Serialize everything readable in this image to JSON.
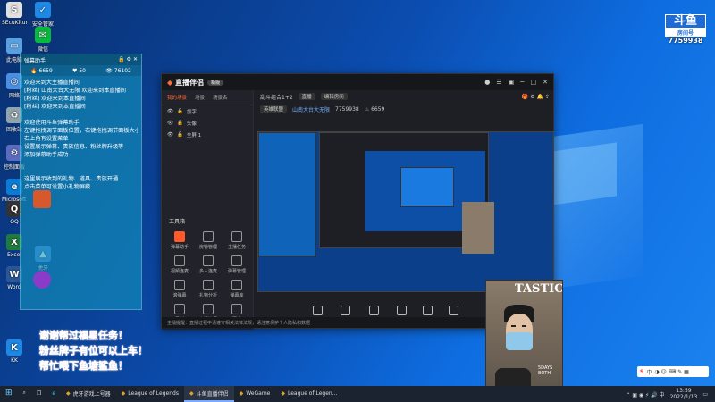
{
  "desktop": {
    "icons": [
      {
        "label": "SEcuKitunt",
        "glyph": "S",
        "color": "#e0e0e0"
      },
      {
        "label": "安全管家",
        "glyph": "✓",
        "color": "#1e88e5"
      },
      {
        "label": "此电脑",
        "glyph": "▭",
        "color": "#5aa0e0"
      },
      {
        "label": "微信",
        "glyph": "✉",
        "color": "#09b83e"
      },
      {
        "label": "网络",
        "glyph": "◎",
        "color": "#4a90e2"
      },
      {
        "label": "回收站",
        "glyph": "♻",
        "color": "#90a4ae"
      },
      {
        "label": "控制面板",
        "glyph": "⚙",
        "color": "#5c6bc0"
      },
      {
        "label": "Microsoft Edge",
        "glyph": "e",
        "color": "#0a7cd6"
      },
      {
        "label": "QQ",
        "glyph": "Q",
        "color": "#333"
      },
      {
        "label": "Excel",
        "glyph": "X",
        "color": "#1f7a3f"
      },
      {
        "label": "Word",
        "glyph": "W",
        "color": "#2b5797"
      },
      {
        "label": "虎牙",
        "glyph": "▲",
        "color": "#4a7fd8"
      },
      {
        "label": "KK",
        "glyph": "K",
        "color": "#1e88e5"
      }
    ],
    "middle_icons": [
      {
        "glyph": "◆",
        "color": "#e06030"
      },
      {
        "glyph": "◆",
        "color": "#8a3cc8"
      }
    ]
  },
  "chat": {
    "title": "弹幕助手",
    "stats": [
      "6659",
      "50",
      "76102"
    ],
    "messages": [
      "欢迎来到大主播直播间",
      "[粉丝] 山南大台大无限  欢迎来到本直播间",
      "[粉丝]  欢迎来到本直播间",
      "[粉丝]  欢迎来到本直播间",
      "",
      "欢迎使用斗鱼弹幕助手",
      "左键拖拽调节面板位置，右键拖拽调节面板大小",
      "右上角有设置菜单",
      "设置展示弹幕、贵族信息、粉丝牌升级等",
      "添加弹幕助手成功",
      "",
      "",
      "这里展示收到的礼物、道具、贵族开通",
      "点击菜单可设置小礼物屏蔽"
    ]
  },
  "overlay_text": [
    "谢谢帮过福星任务！",
    "粉丝牌子有位可以上车！",
    "帮忙喂下鱼塘鲨鱼！"
  ],
  "app": {
    "name": "直播伴侣",
    "version": "新版",
    "scene_tabs": [
      "我的场景",
      "场景",
      "场景名"
    ],
    "sources": [
      "加字",
      "头像",
      "全屏 1"
    ],
    "tools_title": "工具箱",
    "tools": [
      "弹幕助手",
      "房管管理",
      "主播任务",
      "视频连麦",
      "多人连麦",
      "弹幕管理",
      "滚弹幕",
      "礼物分析",
      "弹幕库",
      "录制",
      "直播管理",
      "更多"
    ],
    "room_title": "乱斗组合1+2",
    "room_tag": "直播",
    "room_edit": "编辑房间",
    "room_category": "英雄联盟",
    "room_owner": "山南大台大无限",
    "room_id": "7759938",
    "room_fans": "6659",
    "controls": [
      "直播画面",
      "摄像头",
      "手机投屏",
      "多媒体",
      "麦克风",
      "扬声器"
    ],
    "status": "主播提醒：直播过程中请遵守相关法律法规，请注意保护个人隐私和数据"
  },
  "badge": {
    "top": "斗鱼",
    "sub": "房间号",
    "room": "7759938"
  },
  "cam_text": {
    "big": "TASTIC",
    "small": "5DAYS\nBOTH"
  },
  "taskbar": {
    "items": [
      {
        "label": "虎牙游戏上号器",
        "on": false
      },
      {
        "label": "League of Legends",
        "on": false
      },
      {
        "label": "斗鱼直播伴侣",
        "on": true
      },
      {
        "label": "WeGame",
        "on": false
      },
      {
        "label": "League of Legen...",
        "on": false
      }
    ],
    "time": "13:59",
    "date": "2022/1/13",
    "ime_label": "中"
  }
}
